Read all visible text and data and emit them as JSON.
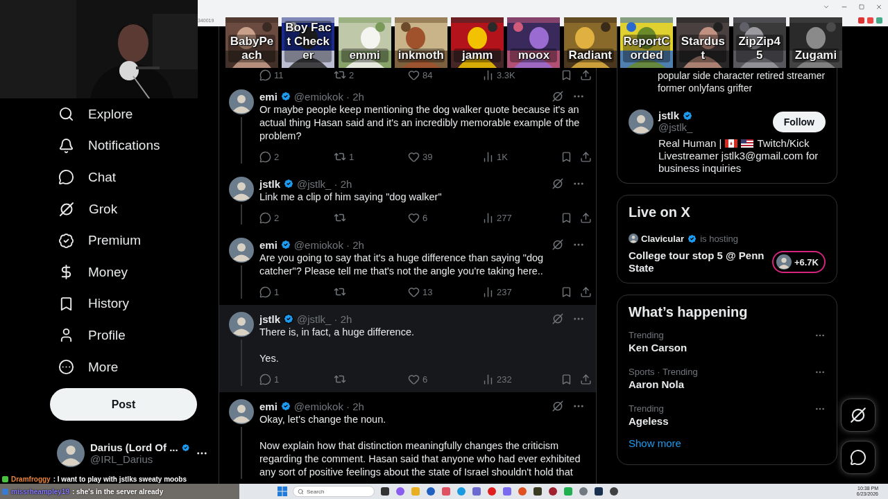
{
  "browser": {
    "url_fragment": "340019"
  },
  "overlay_tiles": [
    {
      "label": "BabyPeach"
    },
    {
      "label": "Boy Fact Checker"
    },
    {
      "label": "emmi"
    },
    {
      "label": "inkmoth"
    },
    {
      "label": "jamm"
    },
    {
      "label": "moox"
    },
    {
      "label": "Radiant"
    },
    {
      "label": "ReportCorded"
    },
    {
      "label": "Stardust"
    },
    {
      "label": "ZipZip45"
    },
    {
      "label": "Zugami"
    }
  ],
  "sidebar": {
    "items": [
      {
        "label": "Explore"
      },
      {
        "label": "Notifications"
      },
      {
        "label": "Chat"
      },
      {
        "label": "Grok"
      },
      {
        "label": "Premium"
      },
      {
        "label": "Money"
      },
      {
        "label": "History"
      },
      {
        "label": "Profile"
      },
      {
        "label": "More"
      }
    ],
    "post_button": "Post",
    "account": {
      "name": "Darius (Lord Of ...",
      "handle": "@IRL_Darius"
    }
  },
  "feed": {
    "previous_actions": {
      "replies": "11",
      "reposts": "2",
      "likes": "84",
      "views": "3.3K"
    },
    "tweets": [
      {
        "name": "emi",
        "meta": "@emiokok · 2h",
        "text": "Or maybe people keep mentioning the dog walker quote because it's an actual thing Hasan said and it's an incredibly memorable example of the problem?",
        "replies": "2",
        "reposts": "1",
        "likes": "39",
        "views": "1K",
        "highlighted": false
      },
      {
        "name": "jstlk",
        "meta": "@jstlk_ · 2h",
        "text": "Link me a clip of him saying \"dog walker\"",
        "replies": "2",
        "likes": "6",
        "views": "277",
        "highlighted": false
      },
      {
        "name": "emi",
        "meta": "@emiokok · 2h",
        "text": "Are you going to say that it's a huge difference than saying \"dog catcher\"? Please tell me that's not the angle you're taking here..",
        "replies": "1",
        "likes": "13",
        "views": "237",
        "highlighted": false
      },
      {
        "name": "jstlk",
        "meta": "@jstlk_ · 2h",
        "text": "There is, in fact, a huge difference.\n\nYes.",
        "replies": "1",
        "likes": "6",
        "views": "232",
        "highlighted": true
      },
      {
        "name": "emi",
        "meta": "@emiokok · 2h",
        "text": "Okay, let's change the noun.\n\nNow explain how that distinction meaningfully changes the criticism regarding the comment. Hasan said that anyone who had ever exhibited any sort of positive feelings about the state of Israel shouldn't hold that",
        "highlighted": false
      }
    ]
  },
  "right_column": {
    "bio_card": {
      "text": "popular side character retired streamer former onlyfans grifter",
      "user": {
        "name": "jstlk",
        "handle": "@jstlk_",
        "follow": "Follow",
        "bio_start": "Real Human |",
        "bio_middle": "Twitch/Kick",
        "bio_end": "Livestreamer jstlk3@gmail.com for business inquiries"
      }
    },
    "live": {
      "title": "Live on X",
      "host": "Clavicular",
      "hosting": "is hosting",
      "stream_title": "College tour stop 5 @ Penn State",
      "viewers": "+6.7K"
    },
    "trending": {
      "title": "What’s happening",
      "items": [
        {
          "context": "Trending",
          "name": "Ken Carson"
        },
        {
          "context": "Sports · Trending",
          "name": "Aaron Nola"
        },
        {
          "context": "Trending",
          "name": "Ageless"
        }
      ],
      "show_more": "Show more"
    }
  },
  "chat": [
    {
      "user": "Dramfroggy",
      "message": ": I want to play with jstlks sweaty moobs",
      "color": "#e8843a"
    },
    {
      "user": "missrheampley19",
      "message": ": she's in the server already",
      "color": "#8a7dff"
    }
  ],
  "taskbar": {
    "search_placeholder": "Search",
    "time": "10:38 PM",
    "date": "6/23/2026"
  }
}
